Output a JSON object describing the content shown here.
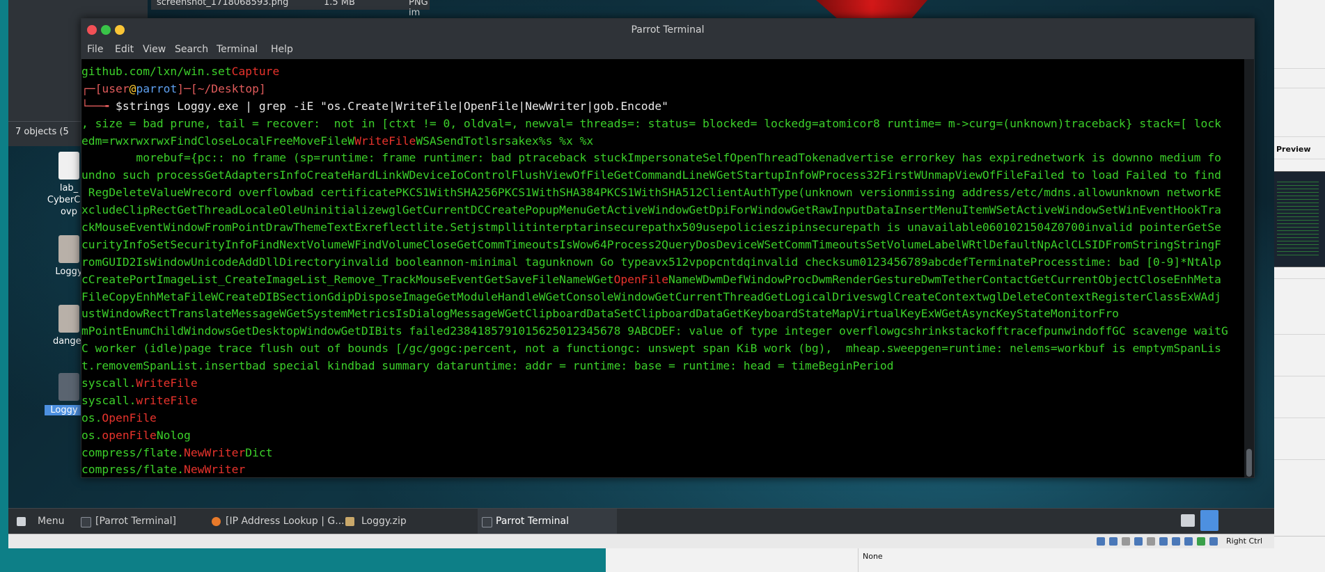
{
  "host": {
    "right_panel_label": "Preview",
    "bottom_value": "None",
    "right_ctrl": "Right Ctrl"
  },
  "desktop": {
    "file_list_top": [
      {
        "name": "screenshot_1718068593.png",
        "size": "1.5 MB",
        "type": "PNG im"
      }
    ],
    "status": "7 objects (5",
    "icons": [
      {
        "label": "lab_\nCyberCas\novp"
      },
      {
        "label": "Loggy"
      },
      {
        "label": "danger"
      },
      {
        "label": "Loggy"
      }
    ]
  },
  "terminal": {
    "title": "Parrot Terminal",
    "menu": [
      "File",
      "Edit",
      "View",
      "Search",
      "Terminal",
      "Help"
    ],
    "prompt_user": "user",
    "prompt_at": "@",
    "prompt_host": "parrot",
    "prompt_path": "~/Desktop",
    "command": "$strings Loggy.exe | grep -iE \"os.Create|WriteFile|OpenFile|NewWriter|gob.Encode\"",
    "lines": {
      "l0a": "github.com/lxn/win.set",
      "l0b": "Capture",
      "l3": ", size = bad prune, tail = recover:  not in [ctxt != 0, oldval=, newval= threads=: status= blocked= lockedg=atomicor8 runtime= m->curg=(unknown)traceback} stack=[ lock",
      "l4a": "edm=rwxrwxrwxFindCloseLocalFreeMoveFileW",
      "l4b": "WriteFile",
      "l4c": "WSASendTotlsrsakex%s %x %x",
      "l5": "        morebuf={pc:: no frame (sp=runtime: frame runtimer: bad ptraceback stuckImpersonateSelfOpenThreadTokenadvertise errorkey has expirednetwork is downno medium fo",
      "l6": "undno such processGetAdaptersInfoCreateHardLinkWDeviceIoControlFlushViewOfFileGetCommandLineWGetStartupInfoWProcess32FirstWUnmapViewOfFileFailed to load Failed to find",
      "l7": " RegDeleteValueWrecord overflowbad certificatePKCS1WithSHA256PKCS1WithSHA384PKCS1WithSHA512ClientAuthType(unknown versionmissing address/etc/mdns.allowunknown networkE",
      "l8": "xcludeClipRectGetThreadLocaleOleUninitializewglGetCurrentDCCreatePopupMenuGetActiveWindowGetDpiForWindowGetRawInputDataInsertMenuItemWSetActiveWindowSetWinEventHookTra",
      "l9": "ckMouseEventWindowFromPointDrawThemeTextExreflectlite.Setjstmpllitinterptarinsecurepathx509usepolicieszipinsecurepath is unavailable0601021504Z0700invalid pointerGetSe",
      "l10": "curityInfoSetSecurityInfoFindNextVolumeWFindVolumeCloseGetCommTimeoutsIsWow64Process2QueryDosDeviceWSetCommTimeoutsSetVolumeLabelWRtlDefaultNpAclCLSIDFromStringStringF",
      "l11": "romGUID2IsWindowUnicodeAddDllDirectoryinvalid booleannon-minimal tagunknown Go typeavx512vpopcntdqinvalid checksum0123456789abcdefTerminateProcesstime: bad [0-9]*NtAlp",
      "l12a": "cCreatePortImageList_CreateImageList_Remove_TrackMouseEventGetSaveFileNameWGet",
      "l12b": "OpenFile",
      "l12c": "NameWDwmDefWindowProcDwmRenderGestureDwmTetherContactGetCurrentObjectCloseEnhMeta",
      "l13": "FileCopyEnhMetaFileWCreateDIBSectionGdipDisposeImageGetModuleHandleWGetConsoleWindowGetCurrentThreadGetLogicalDriveswglCreateContextwglDeleteContextRegisterClassExWAdj",
      "l14": "ustWindowRectTranslateMessageWGetSystemMetricsIsDialogMessageWGetClipboardDataSetClipboardDataGetKeyboardStateMapVirtualKeyExWGetAsyncKeyStateMonitorFro",
      "l15": "mPointEnumChildWindowsGetDesktopWindowGetDIBits failed2384185791015625012345678 9ABCDEF: value of type integer overflowgcshrinkstackofftracefpunwindoffGC scavenge waitG",
      "l16": "C worker (idle)page trace flush out of bounds [/gc/gogc:percent, not a functiongc: unswept span KiB work (bg),  mheap.sweepgen=runtime: nelems=workbuf is emptymSpanLis",
      "l17": "t.removemSpanList.insertbad special kindbad summary dataruntime: addr = runtime: base = runtime: head = timeBeginPeriod",
      "l18a": "syscall.",
      "l18b": "WriteFile",
      "l19a": "syscall.",
      "l19b": "writeFile",
      "l20a": "os.",
      "l20b": "OpenFile",
      "l21a": "os.",
      "l21b": "openFile",
      "l21c": "Nolog",
      "l22a": "compress/flate.",
      "l22b": "NewWriter",
      "l22c": "Dict",
      "l23a": "compress/flate.",
      "l23b": "NewWriter"
    }
  },
  "taskbar": {
    "menu_label": "Menu",
    "items": [
      {
        "label": "[Parrot Terminal]"
      },
      {
        "label": "[IP Address Lookup | G..."
      },
      {
        "label": "Loggy.zip"
      },
      {
        "label": "Parrot Terminal"
      }
    ]
  },
  "colors": {
    "terminal_green": "#3cd02a",
    "match_red": "#e8332c",
    "taskbar": "#2b2f33"
  }
}
